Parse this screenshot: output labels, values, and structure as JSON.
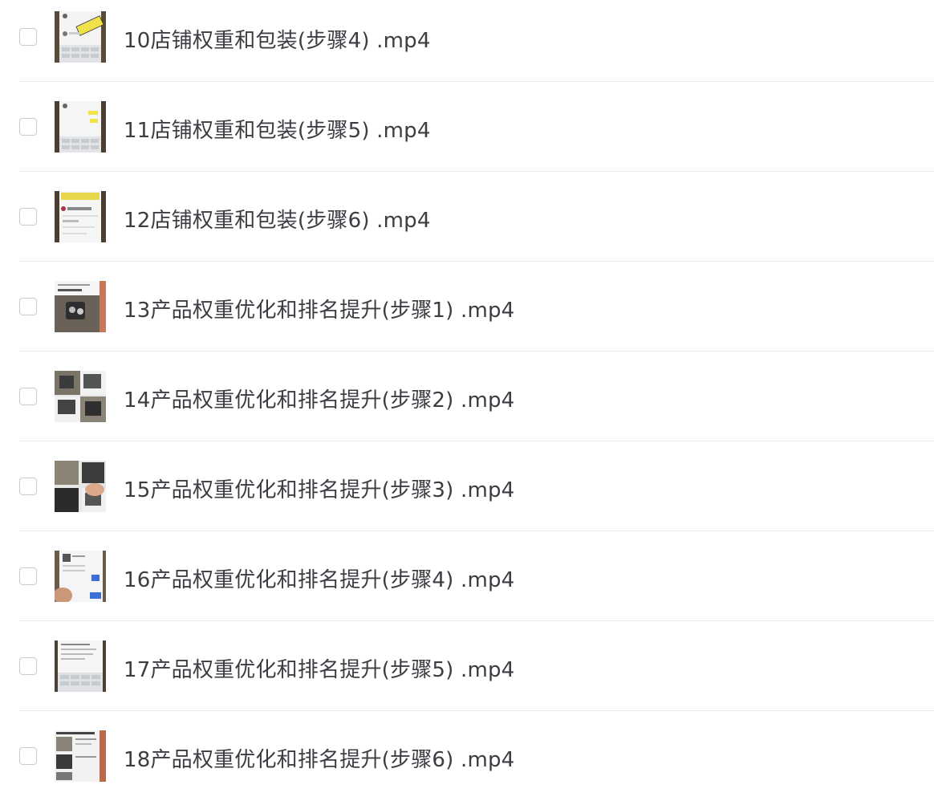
{
  "files": [
    {
      "name": "10店铺权重和包装(步骤4) .mp4",
      "thumb": "chat-keyboard-yellow"
    },
    {
      "name": "11店铺权重和包装(步骤5) .mp4",
      "thumb": "chat-keyboard"
    },
    {
      "name": "12店铺权重和包装(步骤6) .mp4",
      "thumb": "chat-yellow-banner"
    },
    {
      "name": "13产品权重优化和排名提升(步骤1) .mp4",
      "thumb": "product-photo"
    },
    {
      "name": "14产品权重优化和排名提升(步骤2) .mp4",
      "thumb": "product-grid"
    },
    {
      "name": "15产品权重优化和排名提升(步骤3) .mp4",
      "thumb": "product-grid-hand"
    },
    {
      "name": "16产品权重优化和排名提升(步骤4) .mp4",
      "thumb": "phone-screen-hand"
    },
    {
      "name": "17产品权重优化和排名提升(步骤5) .mp4",
      "thumb": "text-keyboard"
    },
    {
      "name": "18产品权重优化和排名提升(步骤6) .mp4",
      "thumb": "product-list"
    }
  ]
}
